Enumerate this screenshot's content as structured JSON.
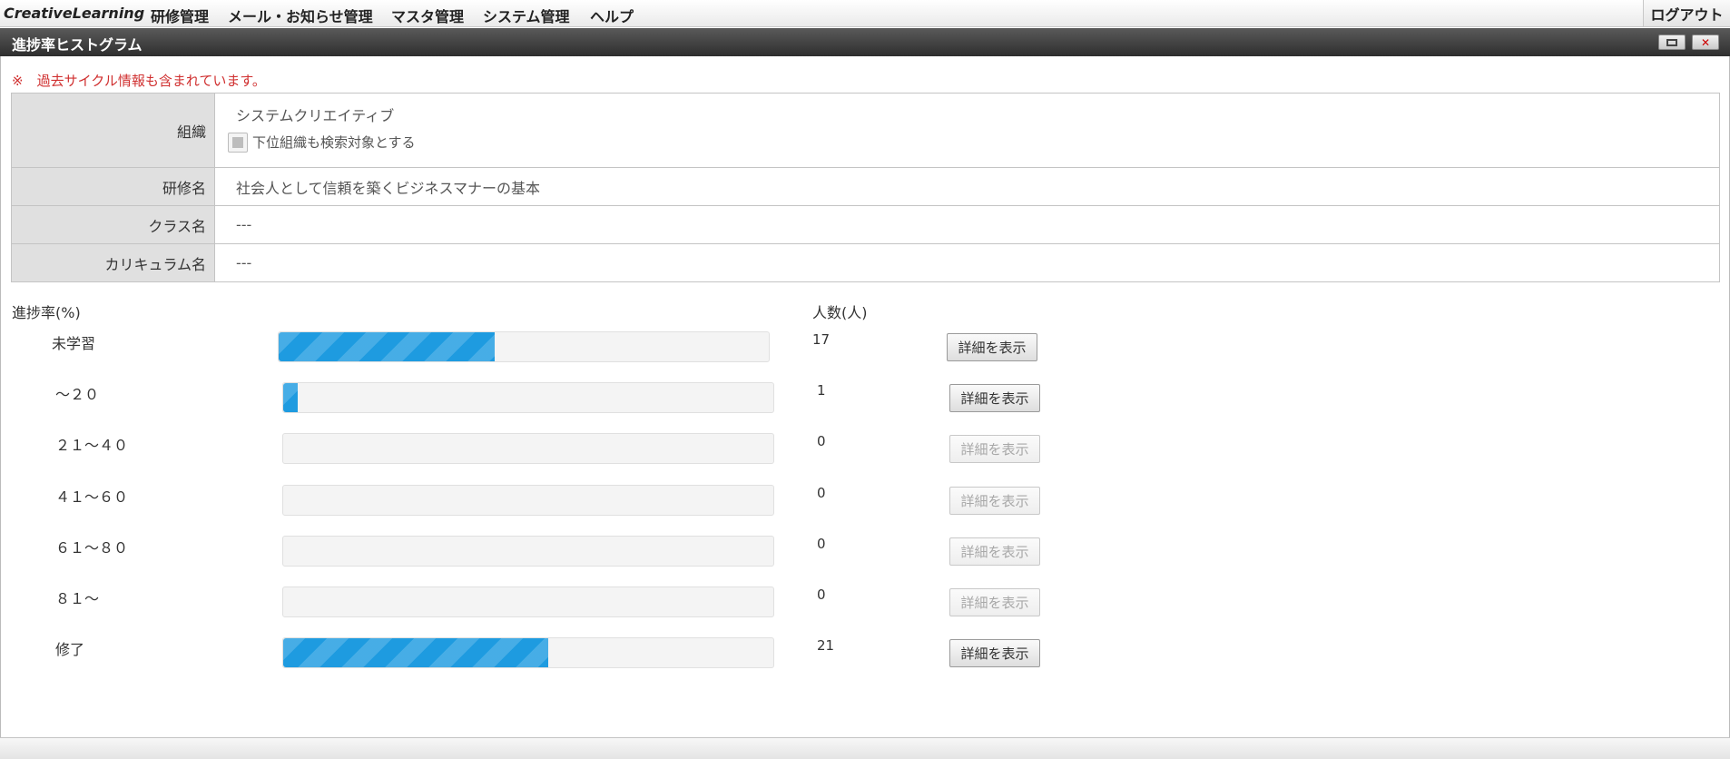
{
  "app": {
    "brand": "CreativeLearning",
    "menu": [
      "研修管理",
      "メール・お知らせ管理",
      "マスタ管理",
      "システム管理",
      "ヘルプ"
    ],
    "logout_label": "ログアウト"
  },
  "window": {
    "title": "進捗率ヒストグラム"
  },
  "notice": "※　過去サイクル情報も含まれています。",
  "conditions": {
    "org_label": "組織",
    "org_value": "システムクリエイティブ",
    "include_sub_label": "下位組織も検索対象とする",
    "include_sub_checked": false,
    "course_label": "研修名",
    "course_value": "社会人として信頼を築くビジネスマナーの基本",
    "class_label": "クラス名",
    "class_value": "---",
    "curriculum_label": "カリキュラム名",
    "curriculum_value": "---"
  },
  "histogram": {
    "rate_header": "進捗率(%)",
    "count_header": "人数(人)",
    "detail_label": "詳細を表示",
    "bar_color": "#1e9be0",
    "rows": [
      {
        "label": "未学習",
        "count": "17",
        "fill": 0.44,
        "enabled": true
      },
      {
        "label": "～２０",
        "count": "1",
        "fill": 0.03,
        "enabled": true
      },
      {
        "label": "２１～４０",
        "count": "0",
        "fill": 0,
        "enabled": false
      },
      {
        "label": "４１～６０",
        "count": "0",
        "fill": 0,
        "enabled": false
      },
      {
        "label": "６１～８０",
        "count": "0",
        "fill": 0,
        "enabled": false
      },
      {
        "label": "８１～",
        "count": "0",
        "fill": 0,
        "enabled": false
      },
      {
        "label": "修了",
        "count": "21",
        "fill": 0.54,
        "enabled": true
      }
    ]
  }
}
